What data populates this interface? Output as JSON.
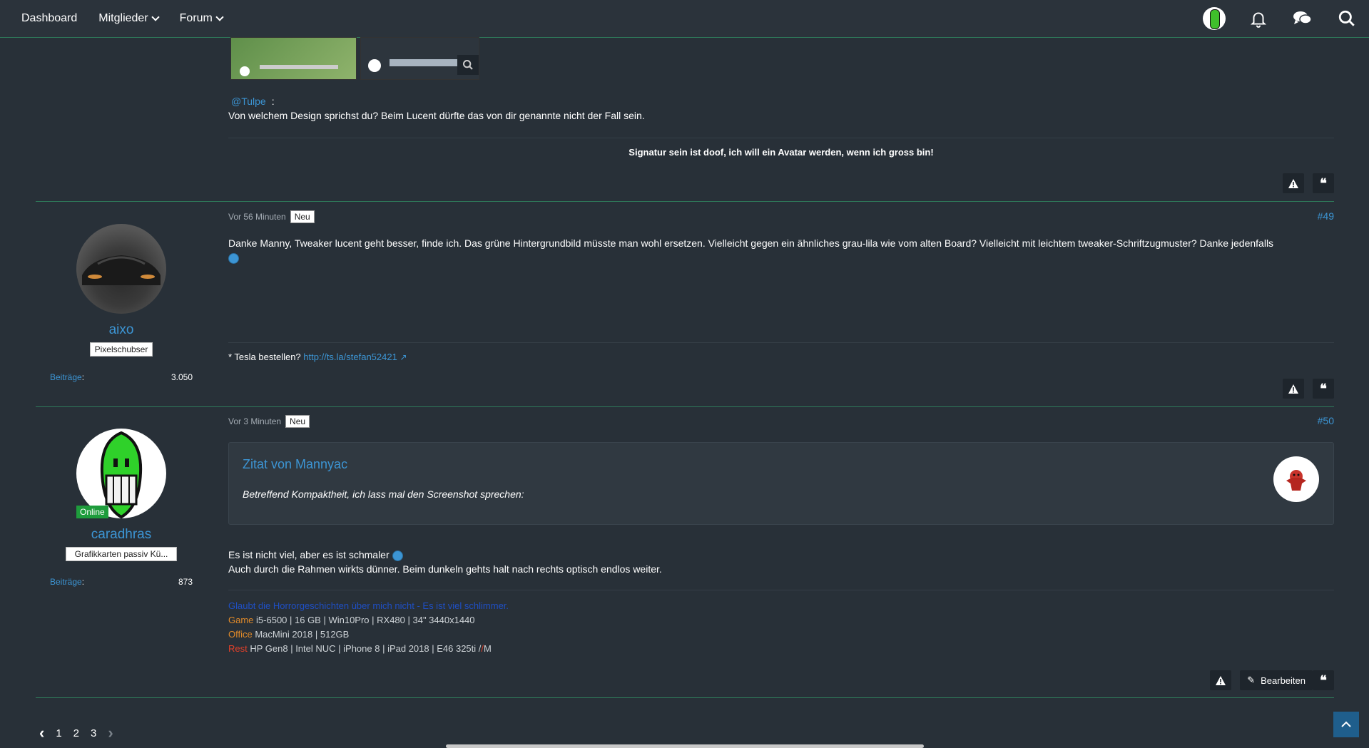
{
  "nav": {
    "items": [
      {
        "label": "Dashboard",
        "dropdown": false
      },
      {
        "label": "Mitglieder",
        "dropdown": true
      },
      {
        "label": "Forum",
        "dropdown": true
      }
    ]
  },
  "top_icons": [
    "user-avatar",
    "bell-icon",
    "chat-icon",
    "search-icon"
  ],
  "post_prev": {
    "mention": "@Tulpe",
    "mention_suffix": ":",
    "text": "Von welchem Design sprichst du? Beim Lucent dürfte das von dir genannte nicht der Fall sein.",
    "signature": "Signatur sein ist doof, ich will ein Avatar werden, wenn ich gross bin!"
  },
  "post49": {
    "time": "Vor 56 Minuten",
    "badge": "Neu",
    "number": "#49",
    "author": "aixo",
    "rank": "Pixelschubser",
    "stat_label": "Beiträge",
    "stat_colon": ":",
    "stat_value": "3.050",
    "text": "Danke Manny, Tweaker lucent geht besser, finde ich. Das grüne Hintergrundbild müsste man wohl ersetzen. Vielleicht gegen ein ähnliches grau-lila wie vom alten Board? Vielleicht mit leichtem tweaker-Schriftzugmuster? Danke jedenfalls",
    "sig_prefix": "* Tesla bestellen?",
    "sig_link": "http://ts.la/stefan52421"
  },
  "post50": {
    "time": "Vor 3 Minuten",
    "badge": "Neu",
    "number": "#50",
    "author": "caradhras",
    "online": "Online",
    "rank": "Grafikkarten passiv Kü...",
    "stat_label": "Beiträge",
    "stat_colon": ":",
    "stat_value": "873",
    "quote_title": "Zitat von Mannyac",
    "quote_text": "Betreffend Kompaktheit, ich lass mal den Screenshot sprechen:",
    "text_line1": "Es ist nicht viel, aber es ist schmaler",
    "text_line2": "Auch durch die Rahmen wirkts dünner. Beim dunkeln gehts halt nach rechts optisch endlos weiter.",
    "sig_line1": "Glaubt die Horrorgeschichten über mich nicht - Es ist viel schlimmer.",
    "sig_game_label": "Game",
    "sig_game": "i5-6500 | 16 GB | Win10Pro | RX480 | 34\" 3440x1440",
    "sig_office_label": "Office",
    "sig_office": "MacMini 2018 | 512GB",
    "sig_rest_label": "Rest",
    "sig_rest": "HP Gen8 | Intel NUC | iPhone 8 | iPad 2018 | E46 325ti /",
    "sig_rest_tail": "M",
    "edit_label": "Bearbeiten"
  },
  "pagination": {
    "pages": [
      "1",
      "2",
      "3"
    ]
  },
  "colors": {
    "accent": "#3c95d4",
    "background": "#283038",
    "separator": "#2f7a5a",
    "online": "#1e9c3c"
  }
}
